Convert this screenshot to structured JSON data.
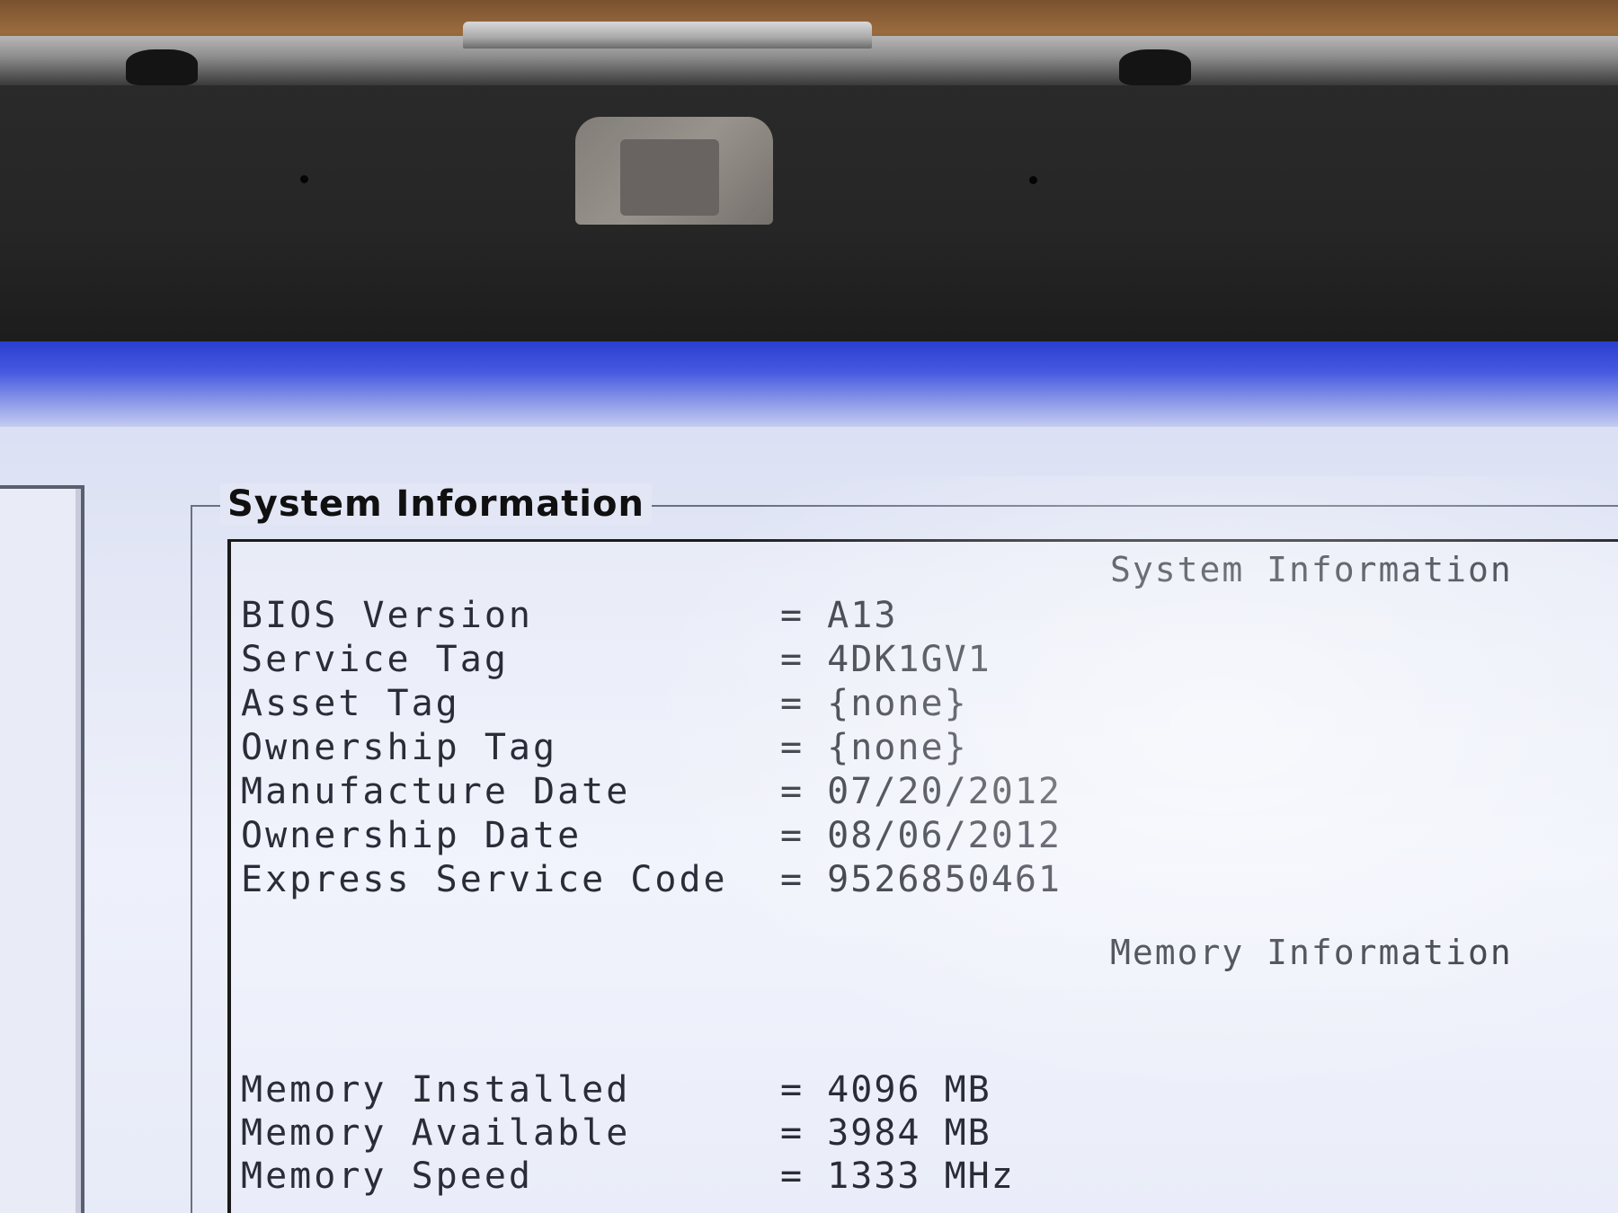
{
  "window": {
    "group_title": "System Information"
  },
  "system_section": {
    "heading": "System Information",
    "rows": [
      {
        "label": "BIOS Version",
        "value": "= A13"
      },
      {
        "label": "Service Tag",
        "value": "= 4DK1GV1"
      },
      {
        "label": "Asset Tag",
        "value": "= {none}"
      },
      {
        "label": "Ownership Tag",
        "value": "= {none}"
      },
      {
        "label": "Manufacture Date",
        "value": "= 07/20/2012"
      },
      {
        "label": "Ownership Date",
        "value": "= 08/06/2012"
      },
      {
        "label": "Express Service Code",
        "value": "= 9526850461"
      }
    ]
  },
  "memory_section": {
    "heading": "Memory Information",
    "rows": [
      {
        "label": "Memory Installed",
        "value": "= 4096 MB"
      },
      {
        "label": "Memory Available",
        "value": "= 3984 MB"
      },
      {
        "label": "Memory Speed",
        "value": "= 1333 MHz"
      }
    ]
  },
  "colors": {
    "header_bar": "#2b3fd0",
    "screen_bg": "#e4e8f6",
    "text": "#2a2c38"
  }
}
